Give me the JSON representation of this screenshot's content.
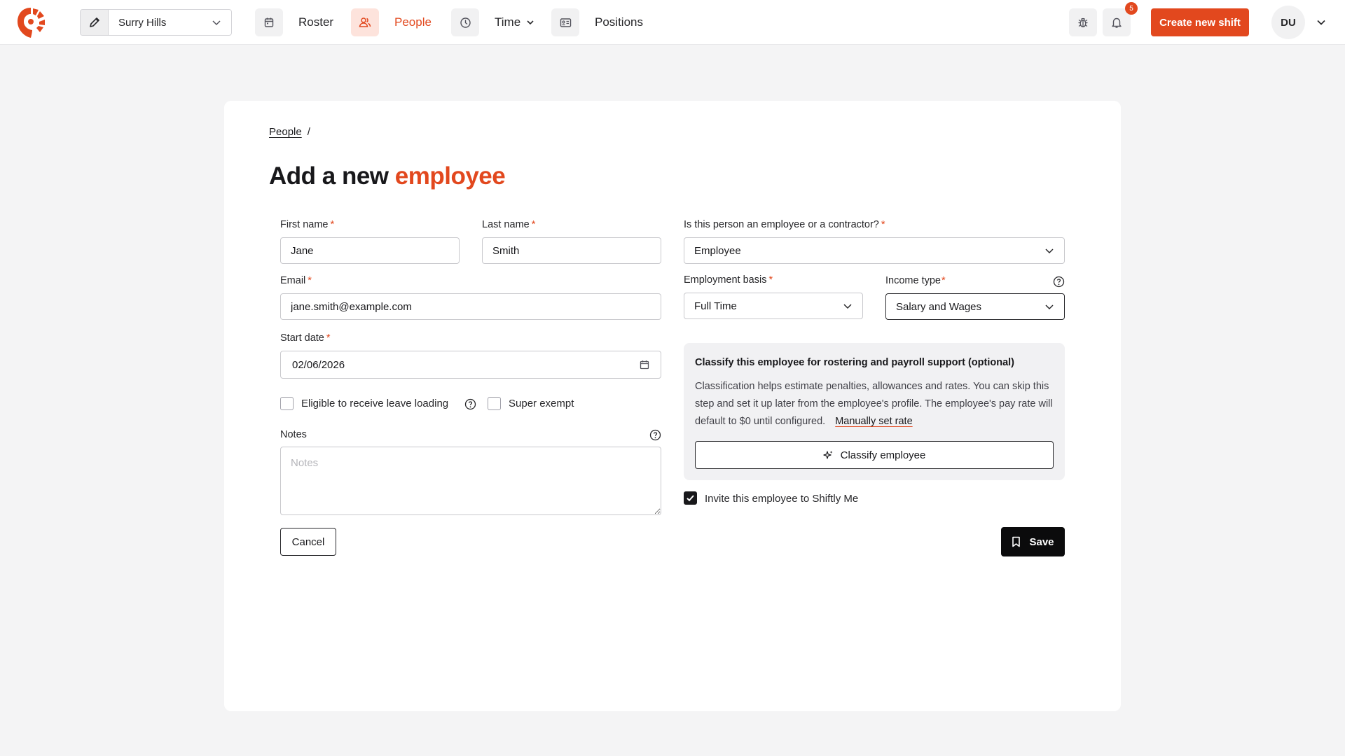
{
  "nav": {
    "location": "Surry Hills",
    "items": [
      {
        "label": "Roster",
        "icon": "calendar-icon"
      },
      {
        "label": "People",
        "icon": "people-icon",
        "active": true
      },
      {
        "label": "Time",
        "icon": "clock-icon"
      },
      {
        "label": "Positions",
        "icon": "id-card-icon"
      }
    ],
    "notification_count": "5",
    "create_button": "Create new shift",
    "avatar_initials": "DU"
  },
  "breadcrumb": {
    "link": "People",
    "separator": "/"
  },
  "title": {
    "prefix": "Add a new",
    "accent": "employee"
  },
  "form": {
    "first_name": {
      "label": "First name",
      "value": "Jane"
    },
    "last_name": {
      "label": "Last name",
      "value": "Smith"
    },
    "email": {
      "label": "Email",
      "value": "jane.smith@example.com"
    },
    "start_date": {
      "label": "Start date",
      "value": "02/06/2026"
    },
    "leave_loading": {
      "label": "Eligible to receive leave loading",
      "checked": false
    },
    "super_exempt": {
      "label": "Super exempt",
      "checked": false
    },
    "notes": {
      "label": "Notes",
      "placeholder": "Notes"
    },
    "worker_type": {
      "label": "Is this person an employee or a contractor?",
      "value": "Employee"
    },
    "employment_basis": {
      "label": "Employment basis",
      "value": "Full Time"
    },
    "income_type": {
      "label": "Income type",
      "value": "Salary and Wages"
    },
    "required_mark": "*"
  },
  "classify": {
    "title": "Classify this employee for rostering and payroll support (optional)",
    "text": "Classification helps estimate penalties, allowances and rates. You can skip this step and set it up later from the employee's profile. The employee's pay rate will default to $0 until configured.",
    "link": "Manually set rate",
    "button": "Classify employee"
  },
  "invite": {
    "label": "Invite this employee to Shiftly Me",
    "checked": true
  },
  "actions": {
    "cancel": "Cancel",
    "save": "Save"
  },
  "colors": {
    "accent": "#e2481e",
    "dark": "#0b0b0c",
    "background": "#f4f4f5"
  }
}
